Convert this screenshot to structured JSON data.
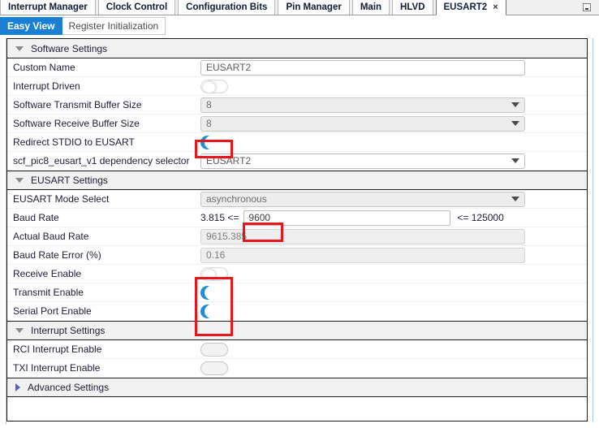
{
  "window": {
    "minimize_icon": "minimize-icon"
  },
  "top_tabs": [
    {
      "label": "Interrupt Manager",
      "active": false,
      "closable": false
    },
    {
      "label": "Clock Control",
      "active": false,
      "closable": false
    },
    {
      "label": "Configuration Bits",
      "active": false,
      "closable": false
    },
    {
      "label": "Pin Manager",
      "active": false,
      "closable": false
    },
    {
      "label": "Main",
      "active": false,
      "closable": false
    },
    {
      "label": "HLVD",
      "active": false,
      "closable": false
    },
    {
      "label": "EUSART2",
      "active": true,
      "closable": true,
      "close_glyph": "×"
    }
  ],
  "sub_tabs": [
    {
      "label": "Easy View",
      "active": true
    },
    {
      "label": "Register Initialization",
      "active": false
    }
  ],
  "sections": [
    {
      "id": "software-settings",
      "title": "Software Settings",
      "expanded": true,
      "arrow": "chevron-down-icon",
      "rows": [
        {
          "id": "custom-name",
          "label": "Custom Name",
          "control": "textbox",
          "value": "EUSART2"
        },
        {
          "id": "interrupt-driven",
          "label": "Interrupt Driven",
          "control": "toggle",
          "state": "off"
        },
        {
          "id": "software-transmit-buffer-size",
          "label": "Software Transmit Buffer Size",
          "control": "dropdown",
          "value": "8"
        },
        {
          "id": "software-receive-buffer-size",
          "label": "Software Receive Buffer Size",
          "control": "dropdown",
          "value": "8"
        },
        {
          "id": "redirect-stdio-to-eusart",
          "label": "Redirect STDIO to EUSART",
          "control": "toggle",
          "state": "crescent",
          "highlighted": true
        },
        {
          "id": "dependency-selector",
          "label": "scf_pic8_eusart_v1 dependency selector",
          "control": "dropdown-white",
          "value": "EUSART2"
        }
      ]
    },
    {
      "id": "eusart-settings",
      "title": "EUSART Settings",
      "expanded": true,
      "arrow": "chevron-down-icon",
      "rows": [
        {
          "id": "eusart-mode-select",
          "label": "EUSART Mode Select",
          "control": "dropdown",
          "value": "asynchronous"
        },
        {
          "id": "baud-rate",
          "label": "Baud Rate",
          "control": "baudrange",
          "min_text": "3.815 <=",
          "value": "9600",
          "max_text": "<= 125000",
          "highlighted": true
        },
        {
          "id": "actual-baud-rate",
          "label": "Actual Baud Rate",
          "control": "readonly",
          "value": "9615.385"
        },
        {
          "id": "baud-rate-error",
          "label": "Baud Rate Error (%)",
          "control": "readonly",
          "value": "0.16"
        },
        {
          "id": "receive-enable",
          "label": "Receive Enable",
          "control": "toggle",
          "state": "off",
          "highlighted": true
        },
        {
          "id": "transmit-enable",
          "label": "Transmit Enable",
          "control": "toggle",
          "state": "crescent",
          "highlighted": true
        },
        {
          "id": "serial-port-enable",
          "label": "Serial Port Enable",
          "control": "toggle",
          "state": "crescent",
          "highlighted": true
        }
      ]
    },
    {
      "id": "interrupt-settings",
      "title": "Interrupt Settings",
      "expanded": true,
      "arrow": "chevron-down-icon",
      "rows": [
        {
          "id": "rci-interrupt-enable",
          "label": "RCI Interrupt Enable",
          "control": "toggle",
          "state": "disabled"
        },
        {
          "id": "txi-interrupt-enable",
          "label": "TXI Interrupt Enable",
          "control": "toggle",
          "state": "disabled"
        }
      ]
    },
    {
      "id": "advanced-settings",
      "title": "Advanced Settings",
      "expanded": false,
      "arrow": "chevron-right-icon",
      "rows": []
    }
  ],
  "colors": {
    "accent_blue": "#1d7fd4",
    "toggle_on_blue": "#1b8ee0",
    "annotation_red": "#e8161a",
    "section_header_bg": "#f1f1f1",
    "collapsed_arrow": "#5b5bbf"
  }
}
